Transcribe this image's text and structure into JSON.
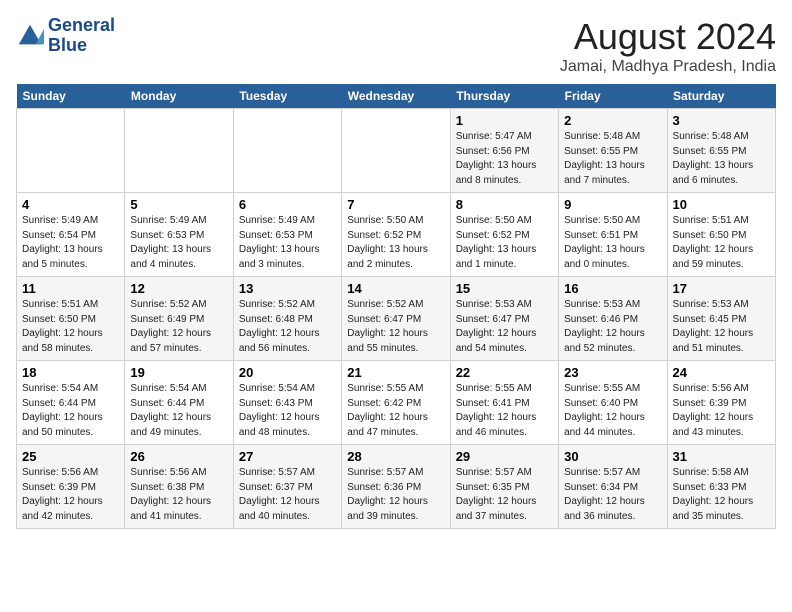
{
  "header": {
    "logo_line1": "General",
    "logo_line2": "Blue",
    "month_year": "August 2024",
    "location": "Jamai, Madhya Pradesh, India"
  },
  "weekdays": [
    "Sunday",
    "Monday",
    "Tuesday",
    "Wednesday",
    "Thursday",
    "Friday",
    "Saturday"
  ],
  "weeks": [
    [
      {
        "day": "",
        "info": ""
      },
      {
        "day": "",
        "info": ""
      },
      {
        "day": "",
        "info": ""
      },
      {
        "day": "",
        "info": ""
      },
      {
        "day": "1",
        "info": "Sunrise: 5:47 AM\nSunset: 6:56 PM\nDaylight: 13 hours\nand 8 minutes."
      },
      {
        "day": "2",
        "info": "Sunrise: 5:48 AM\nSunset: 6:55 PM\nDaylight: 13 hours\nand 7 minutes."
      },
      {
        "day": "3",
        "info": "Sunrise: 5:48 AM\nSunset: 6:55 PM\nDaylight: 13 hours\nand 6 minutes."
      }
    ],
    [
      {
        "day": "4",
        "info": "Sunrise: 5:49 AM\nSunset: 6:54 PM\nDaylight: 13 hours\nand 5 minutes."
      },
      {
        "day": "5",
        "info": "Sunrise: 5:49 AM\nSunset: 6:53 PM\nDaylight: 13 hours\nand 4 minutes."
      },
      {
        "day": "6",
        "info": "Sunrise: 5:49 AM\nSunset: 6:53 PM\nDaylight: 13 hours\nand 3 minutes."
      },
      {
        "day": "7",
        "info": "Sunrise: 5:50 AM\nSunset: 6:52 PM\nDaylight: 13 hours\nand 2 minutes."
      },
      {
        "day": "8",
        "info": "Sunrise: 5:50 AM\nSunset: 6:52 PM\nDaylight: 13 hours\nand 1 minute."
      },
      {
        "day": "9",
        "info": "Sunrise: 5:50 AM\nSunset: 6:51 PM\nDaylight: 13 hours\nand 0 minutes."
      },
      {
        "day": "10",
        "info": "Sunrise: 5:51 AM\nSunset: 6:50 PM\nDaylight: 12 hours\nand 59 minutes."
      }
    ],
    [
      {
        "day": "11",
        "info": "Sunrise: 5:51 AM\nSunset: 6:50 PM\nDaylight: 12 hours\nand 58 minutes."
      },
      {
        "day": "12",
        "info": "Sunrise: 5:52 AM\nSunset: 6:49 PM\nDaylight: 12 hours\nand 57 minutes."
      },
      {
        "day": "13",
        "info": "Sunrise: 5:52 AM\nSunset: 6:48 PM\nDaylight: 12 hours\nand 56 minutes."
      },
      {
        "day": "14",
        "info": "Sunrise: 5:52 AM\nSunset: 6:47 PM\nDaylight: 12 hours\nand 55 minutes."
      },
      {
        "day": "15",
        "info": "Sunrise: 5:53 AM\nSunset: 6:47 PM\nDaylight: 12 hours\nand 54 minutes."
      },
      {
        "day": "16",
        "info": "Sunrise: 5:53 AM\nSunset: 6:46 PM\nDaylight: 12 hours\nand 52 minutes."
      },
      {
        "day": "17",
        "info": "Sunrise: 5:53 AM\nSunset: 6:45 PM\nDaylight: 12 hours\nand 51 minutes."
      }
    ],
    [
      {
        "day": "18",
        "info": "Sunrise: 5:54 AM\nSunset: 6:44 PM\nDaylight: 12 hours\nand 50 minutes."
      },
      {
        "day": "19",
        "info": "Sunrise: 5:54 AM\nSunset: 6:44 PM\nDaylight: 12 hours\nand 49 minutes."
      },
      {
        "day": "20",
        "info": "Sunrise: 5:54 AM\nSunset: 6:43 PM\nDaylight: 12 hours\nand 48 minutes."
      },
      {
        "day": "21",
        "info": "Sunrise: 5:55 AM\nSunset: 6:42 PM\nDaylight: 12 hours\nand 47 minutes."
      },
      {
        "day": "22",
        "info": "Sunrise: 5:55 AM\nSunset: 6:41 PM\nDaylight: 12 hours\nand 46 minutes."
      },
      {
        "day": "23",
        "info": "Sunrise: 5:55 AM\nSunset: 6:40 PM\nDaylight: 12 hours\nand 44 minutes."
      },
      {
        "day": "24",
        "info": "Sunrise: 5:56 AM\nSunset: 6:39 PM\nDaylight: 12 hours\nand 43 minutes."
      }
    ],
    [
      {
        "day": "25",
        "info": "Sunrise: 5:56 AM\nSunset: 6:39 PM\nDaylight: 12 hours\nand 42 minutes."
      },
      {
        "day": "26",
        "info": "Sunrise: 5:56 AM\nSunset: 6:38 PM\nDaylight: 12 hours\nand 41 minutes."
      },
      {
        "day": "27",
        "info": "Sunrise: 5:57 AM\nSunset: 6:37 PM\nDaylight: 12 hours\nand 40 minutes."
      },
      {
        "day": "28",
        "info": "Sunrise: 5:57 AM\nSunset: 6:36 PM\nDaylight: 12 hours\nand 39 minutes."
      },
      {
        "day": "29",
        "info": "Sunrise: 5:57 AM\nSunset: 6:35 PM\nDaylight: 12 hours\nand 37 minutes."
      },
      {
        "day": "30",
        "info": "Sunrise: 5:57 AM\nSunset: 6:34 PM\nDaylight: 12 hours\nand 36 minutes."
      },
      {
        "day": "31",
        "info": "Sunrise: 5:58 AM\nSunset: 6:33 PM\nDaylight: 12 hours\nand 35 minutes."
      }
    ]
  ]
}
